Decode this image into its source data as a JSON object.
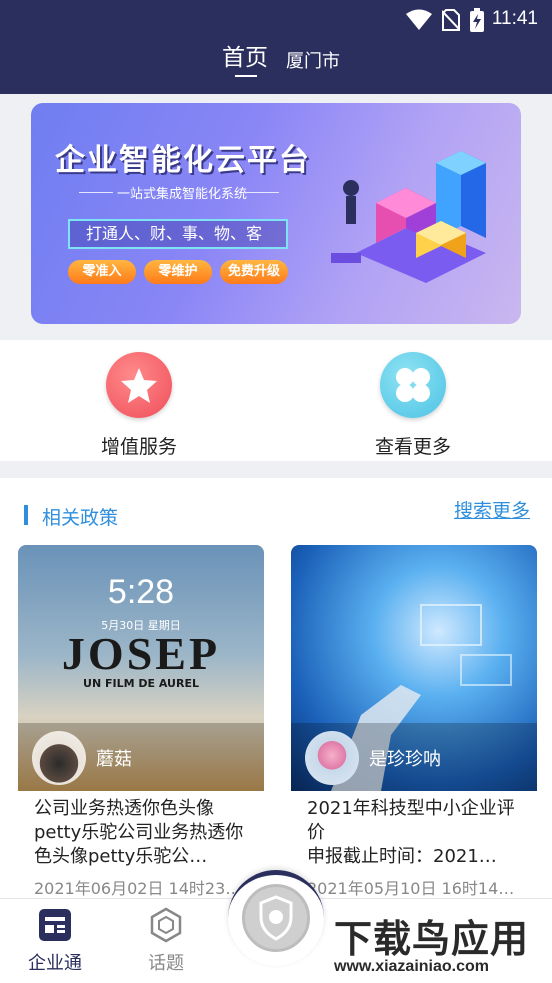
{
  "status_bar": {
    "time": "11:41",
    "icons": [
      "wifi-icon",
      "no-sim-icon",
      "battery-charging-icon"
    ]
  },
  "nav": {
    "title": "首页",
    "city": "厦门市"
  },
  "banner": {
    "title": "企业智能化云平台",
    "subtitle": "一站式集成智能化系统",
    "slogan": "打通人、财、事、物、客",
    "pills": [
      "零准入",
      "零维护",
      "免费升级"
    ]
  },
  "quick_actions": [
    {
      "label": "增值服务",
      "icon": "star-icon"
    },
    {
      "label": "查看更多",
      "icon": "four-dots-icon"
    }
  ],
  "policy": {
    "title": "相关政策",
    "more": "搜索更多",
    "cards": [
      {
        "author": "蘑菇",
        "phone_time": "5:28",
        "phone_date": "5月30日 星期日",
        "poster_title": "JOSEP",
        "poster_sub": "UN FILM DE AUREL",
        "text": "公司业务热透你色头像petty乐驼公司业务热透你色头像petty乐驼公…",
        "date": "2021年06月02日 14时23…"
      },
      {
        "author": "是珍珍呐",
        "text": "2021年科技型中小企业评价\n申报截止时间：2021…",
        "date": "2021年05月10日 16时14…"
      }
    ]
  },
  "tabbar": {
    "tabs": [
      {
        "label": "企业通",
        "icon": "newspaper-icon"
      },
      {
        "label": "话题",
        "icon": "topic-hexagon-icon"
      }
    ],
    "center_icon": "emblem-icon"
  },
  "watermark": {
    "title": "下载鸟应用",
    "url": "www.xiazainiao.com"
  },
  "colors": {
    "header_bg": "#2b2f5e",
    "accent": "#2f8fde",
    "pill": "#ff8a1f"
  }
}
